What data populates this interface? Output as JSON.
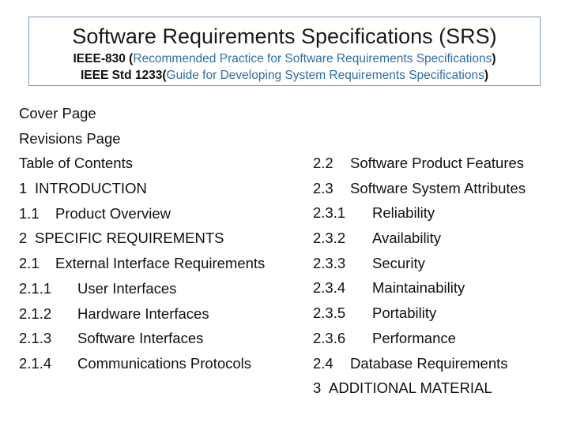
{
  "header": {
    "title": "Software Requirements Specifications (SRS)",
    "line1_prefix": "IEEE-830 (",
    "line1_link": "Recommended Practice for Software Requirements Specifications",
    "line1_suffix": ")",
    "line2_prefix": "IEEE Std 1233(",
    "line2_link": "Guide for Developing System Requirements Specifications",
    "line2_suffix": ")"
  },
  "left_column": [
    {
      "num": "",
      "text": "Cover Page"
    },
    {
      "num": "",
      "text": "Revisions Page"
    },
    {
      "num": "",
      "text": "Table of Contents"
    },
    {
      "num": " 1",
      "text": "INTRODUCTION"
    },
    {
      "num": "1.1",
      "text": "Product Overview"
    },
    {
      "num": "2",
      "text": "SPECIFIC REQUIREMENTS"
    },
    {
      "num": "2.1",
      "text": "External Interface Requirements"
    },
    {
      "num": "2.1.1",
      "text": "User Interfaces"
    },
    {
      "num": "2.1.2",
      "text": "Hardware Interfaces"
    },
    {
      "num": "2.1.3",
      "text": "Software Interfaces"
    },
    {
      "num": "2.1.4",
      "text": "Communications Protocols"
    }
  ],
  "right_column": [
    {
      "num": "2.2",
      "text": "Software Product Features"
    },
    {
      "num": "2.3",
      "text": "Software System Attributes"
    },
    {
      "num": "2.3.1",
      "text": "Reliability"
    },
    {
      "num": "2.3.2",
      "text": "Availability"
    },
    {
      "num": "2.3.3",
      "text": "Security"
    },
    {
      "num": "2.3.4",
      "text": "Maintainability"
    },
    {
      "num": "2.3.5",
      "text": "Portability"
    },
    {
      "num": "2.3.6",
      "text": "Performance"
    },
    {
      "num": "2.4",
      "text": "Database Requirements"
    },
    {
      "num": "3",
      "text": "ADDITIONAL MATERIAL"
    }
  ]
}
